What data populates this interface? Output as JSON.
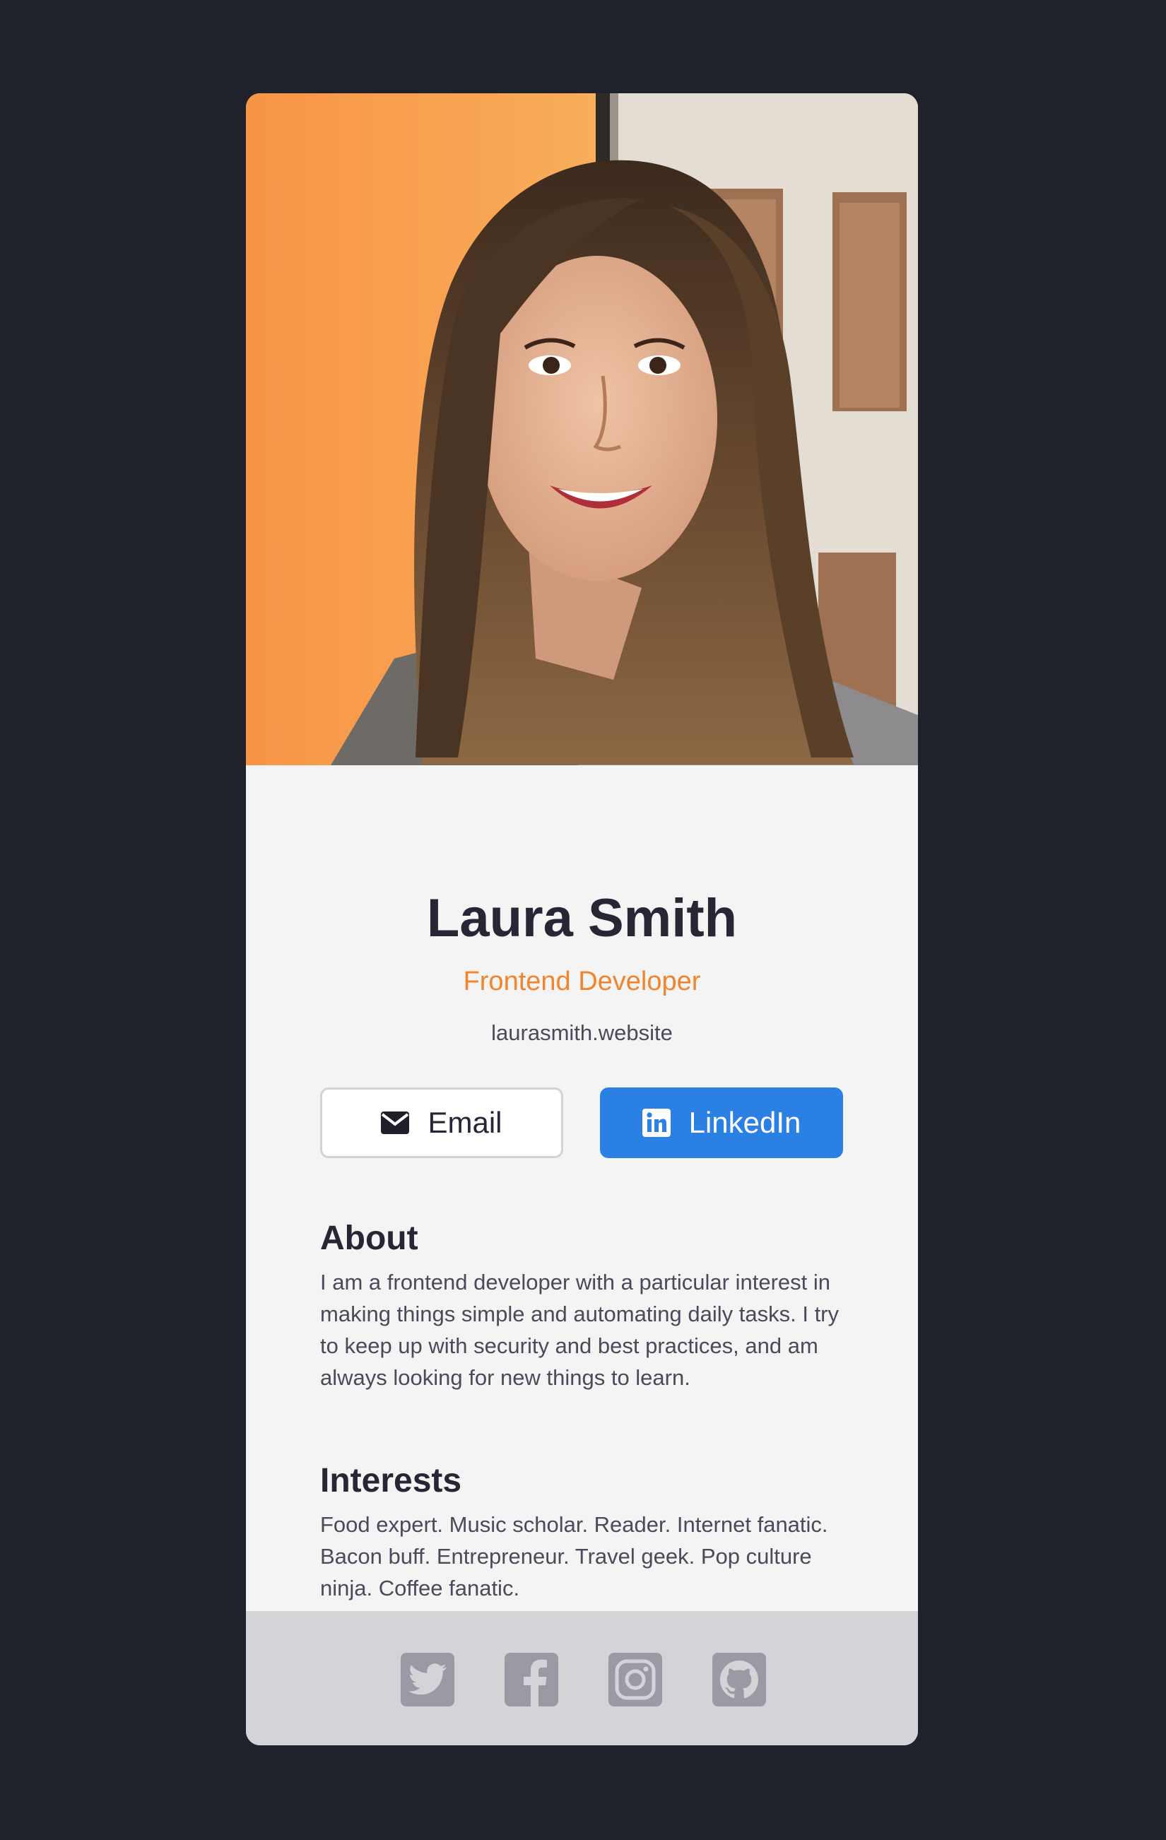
{
  "profile": {
    "name": "Laura Smith",
    "title": "Frontend Developer",
    "website": "laurasmith.website"
  },
  "buttons": {
    "email_label": "Email",
    "linkedin_label": "LinkedIn"
  },
  "about": {
    "heading": "About",
    "body": "I am a frontend developer with a particular interest in making things simple and automating daily tasks. I try to keep up with security and best practices, and am always looking for new things to learn."
  },
  "interests": {
    "heading": "Interests",
    "body": "Food expert. Music scholar. Reader. Internet fanatic. Bacon buff. Entrepreneur. Travel geek. Pop culture ninja. Coffee fanatic."
  },
  "social": [
    {
      "name": "twitter-icon"
    },
    {
      "name": "facebook-icon"
    },
    {
      "name": "instagram-icon"
    },
    {
      "name": "github-icon"
    }
  ],
  "colors": {
    "page_background": "#1f222b",
    "card_background": "#f4f4f5",
    "accent_orange": "#f2842d",
    "linkedin_blue": "#2b80e4",
    "footer_background": "#d4d4d8",
    "social_icon": "#9a9aa5"
  }
}
